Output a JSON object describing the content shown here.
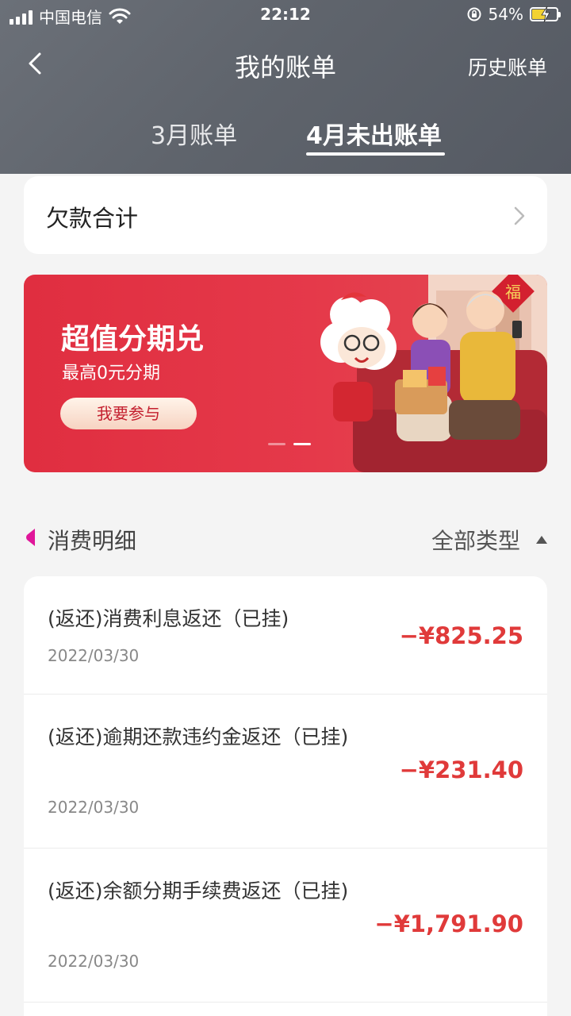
{
  "status_bar": {
    "carrier": "中国电信",
    "time": "22:12",
    "battery": "54%",
    "battery_level": 0.54,
    "icons": [
      "signal-icon",
      "wifi-icon",
      "rotation-lock-icon",
      "battery-icon"
    ]
  },
  "nav": {
    "title": "我的账单",
    "history": "历史账单",
    "back_icon": "chevron-left-icon"
  },
  "tabs": [
    {
      "label": "3月账单",
      "active": false
    },
    {
      "label": "4月未出账单",
      "active": true
    }
  ],
  "debt": {
    "label": "欠款合计",
    "icon": "chevron-right-icon"
  },
  "banner": {
    "title": "超值分期兑",
    "subtitle": "最高0元分期",
    "button": "我要参与",
    "art_glyph": "福",
    "slides": 2,
    "active_slide": 2
  },
  "section": {
    "title": "消费明细",
    "filter": "全部类型",
    "marker_color": "#e0169a"
  },
  "transactions": [
    {
      "title": "(返还)消费利息返还（已挂)",
      "date": "2022/03/30",
      "amount": "−¥825.25"
    },
    {
      "title": "(返还)逾期还款违约金返还（已挂)",
      "date": "2022/03/30",
      "amount": "−¥231.40"
    },
    {
      "title": "(返还)余额分期手续费返还（已挂)",
      "date": "2022/03/30",
      "amount": "−¥1,791.90"
    }
  ],
  "colors": {
    "header": "#5f646c",
    "accent_red": "#e03a3a",
    "banner_red": "#e02e40"
  }
}
